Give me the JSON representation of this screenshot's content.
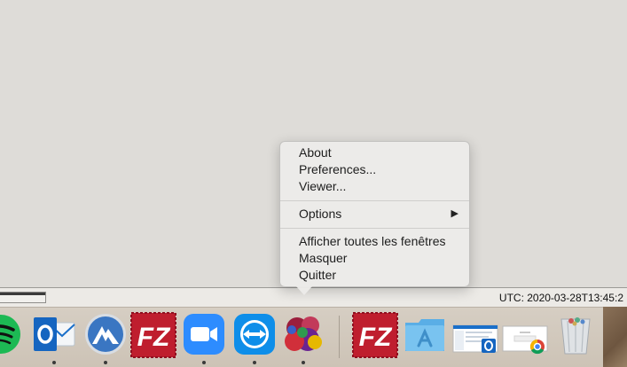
{
  "status_bar": {
    "utc_text": "UTC: 2020-03-28T13:45:2"
  },
  "context_menu": {
    "items": [
      {
        "label": "About"
      },
      {
        "label": "Preferences..."
      },
      {
        "label": "Viewer..."
      },
      {
        "label": "Options",
        "submenu_arrow": "▶"
      },
      {
        "label": "Afficher toutes les fenêtres"
      },
      {
        "label": "Masquer"
      },
      {
        "label": "Quitter"
      }
    ]
  },
  "dock": {
    "items": [
      {
        "icon": "spotify-icon",
        "running": false,
        "color": "#1db954"
      },
      {
        "icon": "outlook-icon",
        "running": true,
        "color": "#1a6fc9",
        "letter": "O"
      },
      {
        "icon": "nordvpn-icon",
        "running": true,
        "color": "#3f7ac7"
      },
      {
        "icon": "filezilla-icon",
        "running": false,
        "color": "#c1272d",
        "letter": "FZ"
      },
      {
        "icon": "zoom-icon",
        "running": true,
        "color": "#2d8cff"
      },
      {
        "icon": "teamviewer-icon",
        "running": true,
        "color": "#0e8ee9"
      },
      {
        "icon": "bubbles-app-icon",
        "running": true,
        "color": "#8a2b4c"
      },
      {
        "icon": "filezilla-icon",
        "running": false,
        "color": "#c1272d",
        "letter": "FZ"
      },
      {
        "icon": "applications-folder-icon",
        "running": false,
        "color": "#68b7ea"
      },
      {
        "icon": "outlook-window-thumbnail-icon",
        "running": false,
        "color": "#1a6fc9"
      },
      {
        "icon": "chrome-window-thumbnail-icon",
        "running": false,
        "color": "#ffffff"
      },
      {
        "icon": "trash-icon",
        "running": false,
        "color": "#bfc3c7"
      }
    ]
  }
}
